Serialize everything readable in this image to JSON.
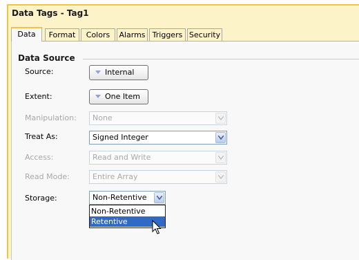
{
  "window": {
    "title": "Data Tags - Tag1"
  },
  "tabs": [
    {
      "label": "Data",
      "active": true
    },
    {
      "label": "Format",
      "active": false
    },
    {
      "label": "Colors",
      "active": false
    },
    {
      "label": "Alarms",
      "active": false
    },
    {
      "label": "Triggers",
      "active": false
    },
    {
      "label": "Security",
      "active": false
    }
  ],
  "section": {
    "title": "Data Source"
  },
  "fields": {
    "source": {
      "label": "Source:",
      "value": "Internal"
    },
    "extent": {
      "label": "Extent:",
      "value": "One Item"
    },
    "manipulation": {
      "label": "Manipulation:",
      "value": "None",
      "enabled": false
    },
    "treat_as": {
      "label": "Treat As:",
      "value": "Signed Integer"
    },
    "access": {
      "label": "Access:",
      "value": "Read and Write",
      "enabled": false
    },
    "read_mode": {
      "label": "Read Mode:",
      "value": "Entire Array",
      "enabled": false
    },
    "storage": {
      "label": "Storage:",
      "value": "Non-Retentive"
    }
  },
  "storage_dropdown": {
    "open": true,
    "options": [
      "Non-Retentive",
      "Retentive"
    ],
    "highlighted": "Retentive"
  },
  "colors": {
    "accent": "#f0c545",
    "panel_bg": "#fdf3c9",
    "selection": "#316ac5"
  },
  "icons": [
    "chevron-down-icon",
    "mouse-cursor-icon"
  ]
}
